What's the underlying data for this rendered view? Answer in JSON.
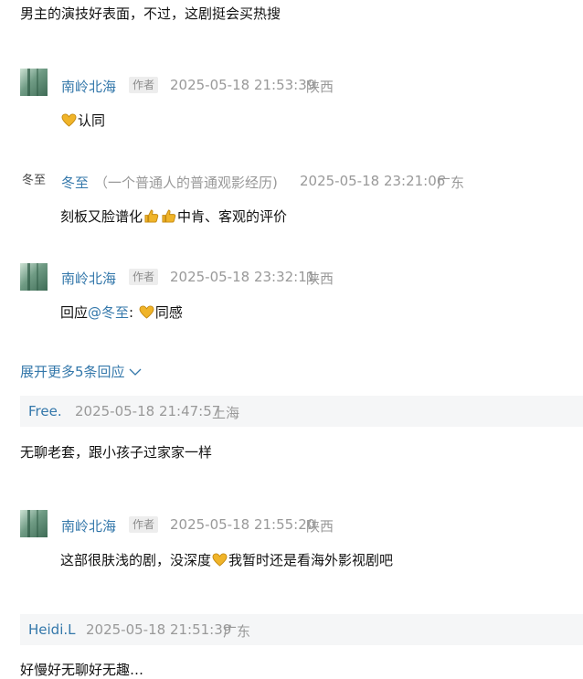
{
  "comments": [
    {
      "text": "男主的演技好表面，不过，这剧挺会买热搜"
    }
  ],
  "replies": [
    {
      "author": "南岭北海",
      "tag": "作者",
      "time": "2025-05-18 21:53:39",
      "location": "陕西",
      "text_after": "认同"
    },
    {
      "author": "冬至",
      "note": "（一个普通人的普通观影经历)",
      "time": "2025-05-18 23:21:06",
      "location": "广东",
      "text_before": "刻板又脸谱化",
      "text_after": "中肯、客观的评价",
      "avatar_text": "冬至"
    },
    {
      "author": "南岭北海",
      "tag": "作者",
      "time": "2025-05-18 23:32:11",
      "location": "陕西",
      "reply_prefix": "回应",
      "mention": "@冬至",
      "colon": ":",
      "text_after": "同感"
    }
  ],
  "expand_more": "展开更多5条回应",
  "comment2": {
    "author": "Free.",
    "time": "2025-05-18 21:47:57",
    "location": "上海",
    "text": "无聊老套，跟小孩子过家家一样"
  },
  "reply2": {
    "author": "南岭北海",
    "tag": "作者",
    "time": "2025-05-18 21:55:20",
    "location": "陕西",
    "text_before": "这部很肤浅的剧，没深度",
    "text_after": "我暂时还是看海外影视剧吧"
  },
  "comment3": {
    "author": "Heidi.L",
    "time": "2025-05-18 21:51:39",
    "location": "广东",
    "text": "好慢好无聊好无趣…"
  },
  "colors": {
    "link": "#3377aa",
    "meta": "#999999",
    "quote_bg": "#f5f6f7",
    "emoji": "#f0b429"
  },
  "icons": [
    "heart-hands-emoji",
    "thumbs-up-emoji",
    "chevron-down-icon"
  ]
}
